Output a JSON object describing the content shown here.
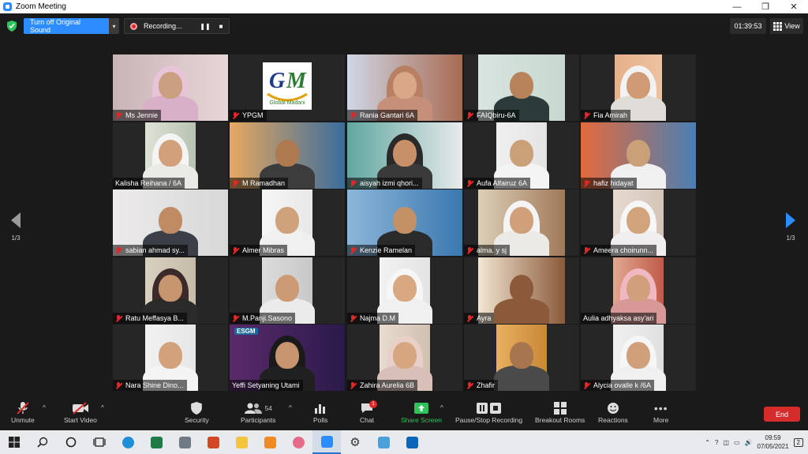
{
  "window": {
    "title": "Zoom Meeting",
    "minimize": "—",
    "restore": "❐",
    "close": "✕"
  },
  "topbar": {
    "original_sound_label": "Turn off Original Sound",
    "recording_label": "Recording...",
    "pause_icon": "❚❚",
    "stop_icon": "■",
    "timer": "01:39:53",
    "view_label": "View"
  },
  "pager": {
    "left_label": "1/3",
    "right_label": "1/3"
  },
  "participants": [
    {
      "name": "Ms Jennie",
      "muted": true
    },
    {
      "name": "YPGM",
      "muted": true
    },
    {
      "name": "Rania Gantari 6A",
      "muted": true
    },
    {
      "name": "FAIQbiru-6A",
      "muted": true
    },
    {
      "name": "Fia Amirah",
      "muted": true
    },
    {
      "name": "Kalisha Reihana / 6A",
      "muted": false
    },
    {
      "name": "M Ramadhan",
      "muted": true
    },
    {
      "name": "aisyah izmi qhori...",
      "muted": true
    },
    {
      "name": "Aufa Alfairuz 6A",
      "muted": true
    },
    {
      "name": "hafiz hidayat",
      "muted": true
    },
    {
      "name": "sabian ahmad sy...",
      "muted": true
    },
    {
      "name": "Almer Mibras",
      "muted": true
    },
    {
      "name": "Kenzie Ramelan",
      "muted": true
    },
    {
      "name": "alma. y sj",
      "muted": true
    },
    {
      "name": "Ameera choirunn...",
      "muted": true
    },
    {
      "name": "Ratu Meffasya B...",
      "muted": true
    },
    {
      "name": "M.Panji.Sasono",
      "muted": true
    },
    {
      "name": "Najma D.M",
      "muted": true
    },
    {
      "name": "Ayra",
      "muted": true
    },
    {
      "name": "Aulia adhyaksa asy'ari",
      "muted": false
    },
    {
      "name": "Nara Shine Dino...",
      "muted": true
    },
    {
      "name": "Yeffi Setyaning Utami",
      "muted": false
    },
    {
      "name": "Zahira Aurelia 6B",
      "muted": true
    },
    {
      "name": "Zhafir",
      "muted": true
    },
    {
      "name": "Alycia ovalle k /6A",
      "muted": true
    }
  ],
  "logo_text": {
    "letters": "GM",
    "caption": "Global Madani"
  },
  "active_banner": "ESGM",
  "toolbar": {
    "unmute": "Unmute",
    "start_video": "Start Video",
    "security": "Security",
    "participants": "Participants",
    "participants_count": "54",
    "polls": "Polls",
    "chat": "Chat",
    "chat_badge": "1",
    "share_screen": "Share Screen",
    "pause_stop_recording": "Pause/Stop Recording",
    "breakout_rooms": "Breakout Rooms",
    "reactions": "Reactions",
    "more": "More",
    "end": "End"
  },
  "taskbar": {
    "time": "09:59",
    "date": "07/05/2021",
    "notifications": "2"
  },
  "colors": {
    "zoom_blue": "#2d8cff",
    "end_red": "#d52b2b",
    "share_green": "#2ec35b",
    "muted_red": "#e02828",
    "active_border": "#f0e68c"
  }
}
